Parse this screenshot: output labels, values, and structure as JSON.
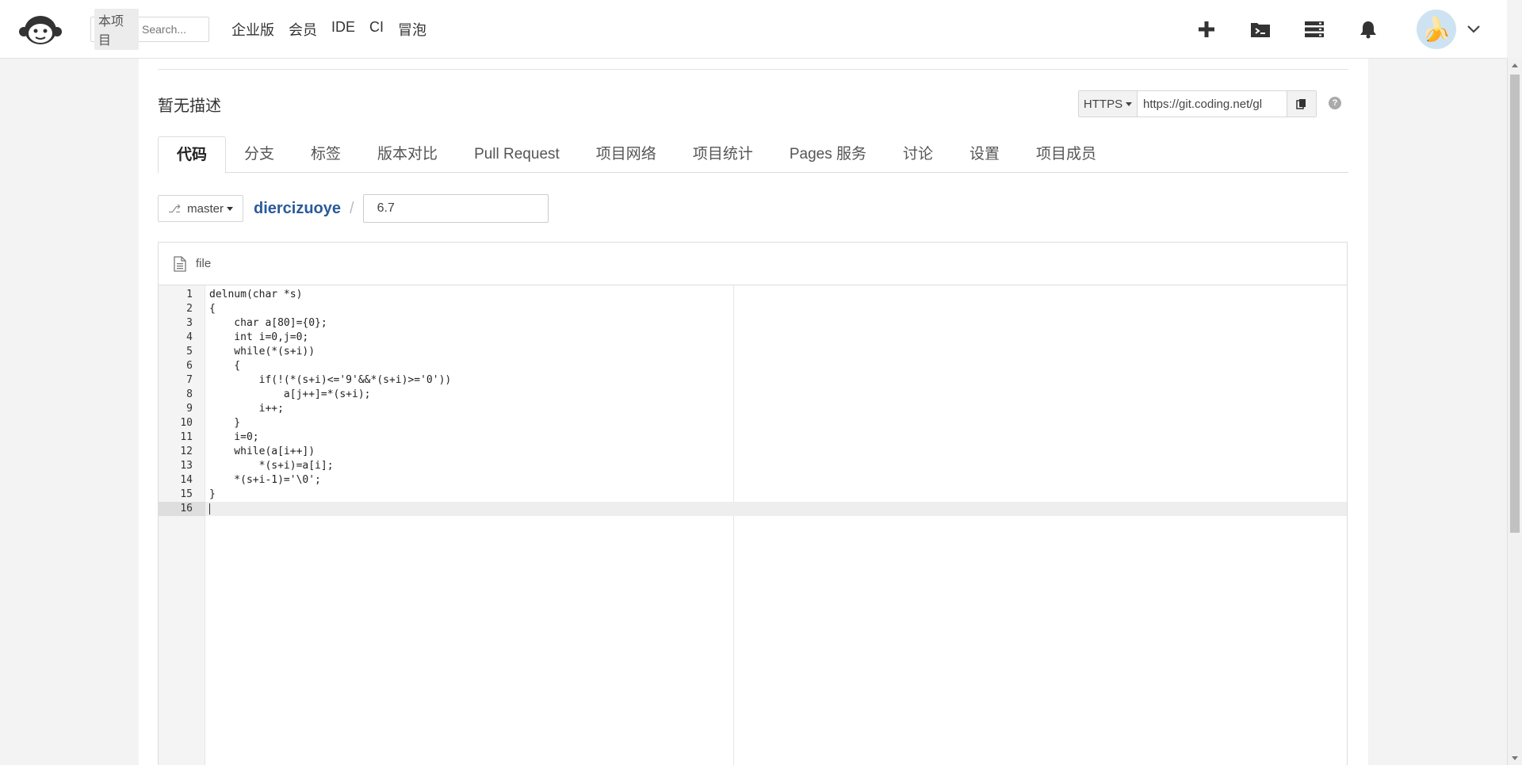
{
  "nav": {
    "search_scope": "本项目",
    "search_placeholder": "Search...",
    "links": [
      "企业版",
      "会员",
      "IDE",
      "CI",
      "冒泡"
    ]
  },
  "project": {
    "description": "暂无描述",
    "clone_protocol": "HTTPS",
    "clone_url": "https://git.coding.net/gl"
  },
  "tabs": [
    "代码",
    "分支",
    "标签",
    "版本对比",
    "Pull Request",
    "项目网络",
    "项目统计",
    "Pages 服务",
    "讨论",
    "设置",
    "项目成员"
  ],
  "breadcrumb": {
    "branch": "master",
    "repo": "diercizuoye",
    "separator": "/",
    "filename": "6.7"
  },
  "editor": {
    "header_label": "file",
    "current_line": 16,
    "lines": [
      {
        "n": "1",
        "text": "delnum(char *s)"
      },
      {
        "n": "2",
        "text": "{"
      },
      {
        "n": "3",
        "text": "    char a[80]={0};"
      },
      {
        "n": "4",
        "text": "    int i=0,j=0;"
      },
      {
        "n": "5",
        "text": "    while(*(s+i))"
      },
      {
        "n": "6",
        "text": "    {"
      },
      {
        "n": "7",
        "text": "        if(!(*(s+i)<='9'&&*(s+i)>='0'))"
      },
      {
        "n": "8",
        "text": "            a[j++]=*(s+i);"
      },
      {
        "n": "9",
        "text": "        i++;"
      },
      {
        "n": "10",
        "text": "    }"
      },
      {
        "n": "11",
        "text": "    i=0;"
      },
      {
        "n": "12",
        "text": "    while(a[i++])"
      },
      {
        "n": "13",
        "text": "        *(s+i)=a[i];"
      },
      {
        "n": "14",
        "text": "    *(s+i-1)='\\0';"
      },
      {
        "n": "15",
        "text": "}"
      },
      {
        "n": "16",
        "text": ""
      }
    ]
  }
}
